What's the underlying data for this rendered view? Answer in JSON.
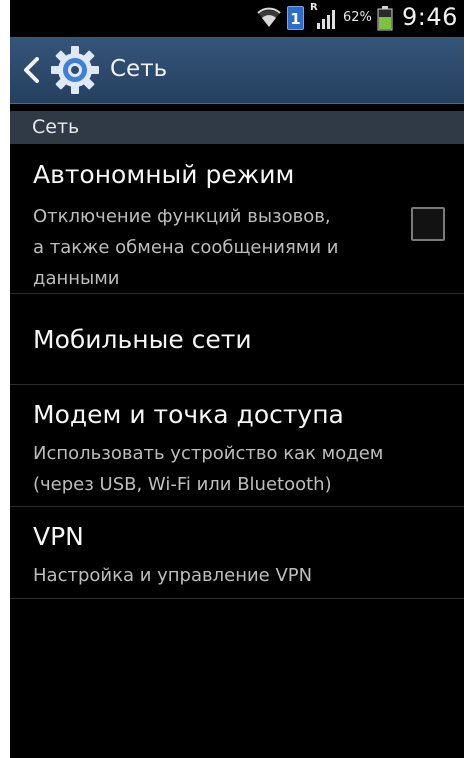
{
  "status_bar": {
    "sim_slot": "1",
    "roaming": "R",
    "battery_percent": "62%",
    "time": "9:46",
    "icons": [
      "wifi-icon",
      "sim-card-icon",
      "signal-icon",
      "battery-icon"
    ]
  },
  "action_bar": {
    "title": "Сеть",
    "icons": [
      "back-chevron-icon",
      "gear-icon"
    ]
  },
  "section": {
    "label": "Сеть"
  },
  "items": [
    {
      "title": "Автономный режим",
      "summary": "Отключение функций вызовов,\nа также обмена сообщениями и\nданными",
      "checked": false
    },
    {
      "title": "Мобильные сети"
    },
    {
      "title": "Модем и точка доступа",
      "summary": "Использовать устройство как модем\n(через USB, Wi-Fi или Bluetooth)"
    },
    {
      "title": "VPN",
      "summary": "Настройка и управление VPN"
    }
  ],
  "colors": {
    "action_bar": "#2f4b6d",
    "section_header": "#2f3a46",
    "background": "#000000",
    "battery": "#7cc243",
    "sim_badge": "#2d6cc9"
  }
}
